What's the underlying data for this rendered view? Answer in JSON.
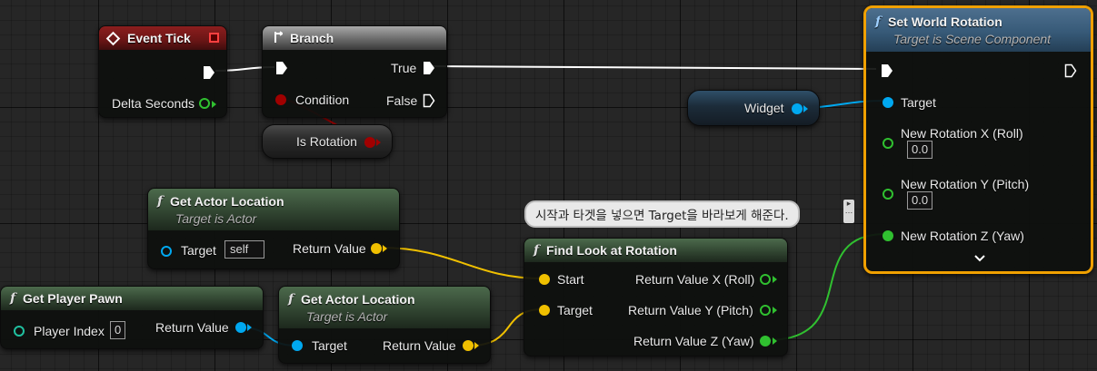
{
  "event_tick": {
    "title": "Event Tick",
    "delta_seconds": "Delta Seconds"
  },
  "branch": {
    "title": "Branch",
    "condition": "Condition",
    "true_label": "True",
    "false_label": "False"
  },
  "is_rotation": {
    "label": "Is Rotation"
  },
  "widget_var": {
    "label": "Widget"
  },
  "set_world_rotation": {
    "title": "Set World Rotation",
    "subtitle": "Target is Scene Component",
    "target": "Target",
    "roll_label": "New Rotation X (Roll)",
    "roll_value": "0.0",
    "pitch_label": "New Rotation Y (Pitch)",
    "pitch_value": "0.0",
    "yaw_label": "New Rotation Z (Yaw)"
  },
  "get_actor_location_1": {
    "title": "Get Actor Location",
    "subtitle": "Target is Actor",
    "target": "Target",
    "target_value": "self",
    "return_value": "Return Value"
  },
  "comment": {
    "text": "시작과 타겟을 넣으면 Target을 바라보게 해준다."
  },
  "find_look_at_rotation": {
    "title": "Find Look at Rotation",
    "start": "Start",
    "target": "Target",
    "ret_x": "Return Value X (Roll)",
    "ret_y": "Return Value Y (Pitch)",
    "ret_z": "Return Value Z (Yaw)"
  },
  "get_player_pawn": {
    "title": "Get Player Pawn",
    "player_index": "Player Index",
    "player_index_value": "0",
    "return_value": "Return Value"
  },
  "get_actor_location_2": {
    "title": "Get Actor Location",
    "subtitle": "Target is Actor",
    "target": "Target",
    "return_value": "Return Value"
  },
  "colors": {
    "exec": "#ffffff",
    "bool": "#a00000",
    "object": "#00a8f0",
    "vector": "#f0c000",
    "float": "#30c030",
    "selection": "#f0a000"
  }
}
